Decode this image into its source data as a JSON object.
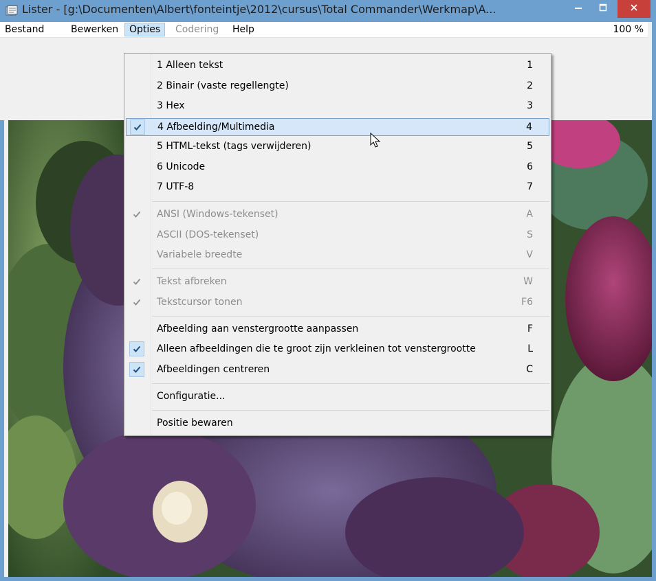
{
  "window": {
    "title": "Lister - [g:\\Documenten\\Albert\\fonteintje\\2012\\cursus\\Total Commander\\Werkmap\\A...",
    "icon": "lister-app-icon",
    "minimize": "minimize-icon",
    "maximize": "maximize-icon",
    "close": "close-icon"
  },
  "menubar": {
    "items": [
      "Bestand",
      "Bewerken",
      "Opties",
      "Codering",
      "Help"
    ],
    "active": "Opties",
    "disabled": [
      "Codering"
    ],
    "zoom": "100 %"
  },
  "opties_menu": {
    "items": [
      {
        "label": "1 Alleen tekst",
        "key": "1",
        "checked": false,
        "enabled": true,
        "highlighted": false
      },
      {
        "label": "2 Binair (vaste regellengte)",
        "key": "2",
        "checked": false,
        "enabled": true,
        "highlighted": false
      },
      {
        "label": "3 Hex",
        "key": "3",
        "checked": false,
        "enabled": true,
        "highlighted": false
      },
      {
        "label": "4 Afbeelding/Multimedia",
        "key": "4",
        "checked": true,
        "enabled": true,
        "highlighted": true
      },
      {
        "label": "5 HTML-tekst (tags verwijderen)",
        "key": "5",
        "checked": false,
        "enabled": true,
        "highlighted": false
      },
      {
        "label": "6 Unicode",
        "key": "6",
        "checked": false,
        "enabled": true,
        "highlighted": false
      },
      {
        "label": "7 UTF-8",
        "key": "7",
        "checked": false,
        "enabled": true,
        "highlighted": false
      },
      {
        "label": "ANSI (Windows-tekenset)",
        "key": "A",
        "checked": true,
        "enabled": false,
        "highlighted": false
      },
      {
        "label": "ASCII (DOS-tekenset)",
        "key": "S",
        "checked": false,
        "enabled": false,
        "highlighted": false
      },
      {
        "label": "Variabele breedte",
        "key": "V",
        "checked": false,
        "enabled": false,
        "highlighted": false
      },
      {
        "label": "Tekst afbreken",
        "key": "W",
        "checked": true,
        "enabled": false,
        "highlighted": false
      },
      {
        "label": "Tekstcursor tonen",
        "key": "F6",
        "checked": true,
        "enabled": false,
        "highlighted": false
      },
      {
        "label": "Afbeelding aan venstergrootte aanpassen",
        "key": "F",
        "checked": false,
        "enabled": true,
        "highlighted": false
      },
      {
        "label": "Alleen afbeeldingen die te groot zijn verkleinen tot venstergrootte",
        "key": "L",
        "checked": true,
        "enabled": true,
        "highlighted": false
      },
      {
        "label": "Afbeeldingen centreren",
        "key": "C",
        "checked": true,
        "enabled": true,
        "highlighted": false
      },
      {
        "label": "Configuratie...",
        "key": "",
        "checked": false,
        "enabled": true,
        "highlighted": false
      },
      {
        "label": "Positie bewaren",
        "key": "",
        "checked": false,
        "enabled": true,
        "highlighted": false
      }
    ]
  },
  "colors": {
    "titlebar": "#6ea0cf",
    "close_button": "#c7403a",
    "highlight": "#d5e7f8",
    "check_color": "#1e4f86",
    "disabled_text": "#8d8d8d"
  }
}
